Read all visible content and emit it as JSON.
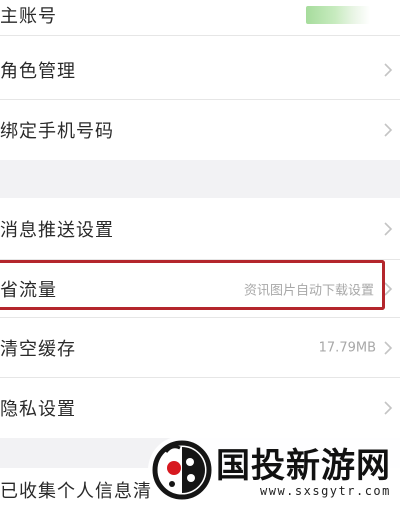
{
  "settings": {
    "main_account": {
      "label": "主账号"
    },
    "role_management": {
      "label": "角色管理"
    },
    "bind_phone": {
      "label": "绑定手机号码"
    },
    "push_settings": {
      "label": "消息推送设置"
    },
    "data_saver": {
      "label": "省流量",
      "value": "资讯图片自动下载设置"
    },
    "clear_cache": {
      "label": "清空缓存",
      "value": "17.79MB"
    },
    "privacy": {
      "label": "隐私设置"
    },
    "personal_info": {
      "label": "已收集个人信息清"
    }
  },
  "watermark": {
    "title": "国投新游网",
    "url": "www.sxsgytr.com"
  },
  "colors": {
    "highlight_border": "#b4262c",
    "section_gap": "#f2f2f4",
    "text_primary": "#2a2a2a",
    "text_secondary": "#a8a8a8"
  }
}
